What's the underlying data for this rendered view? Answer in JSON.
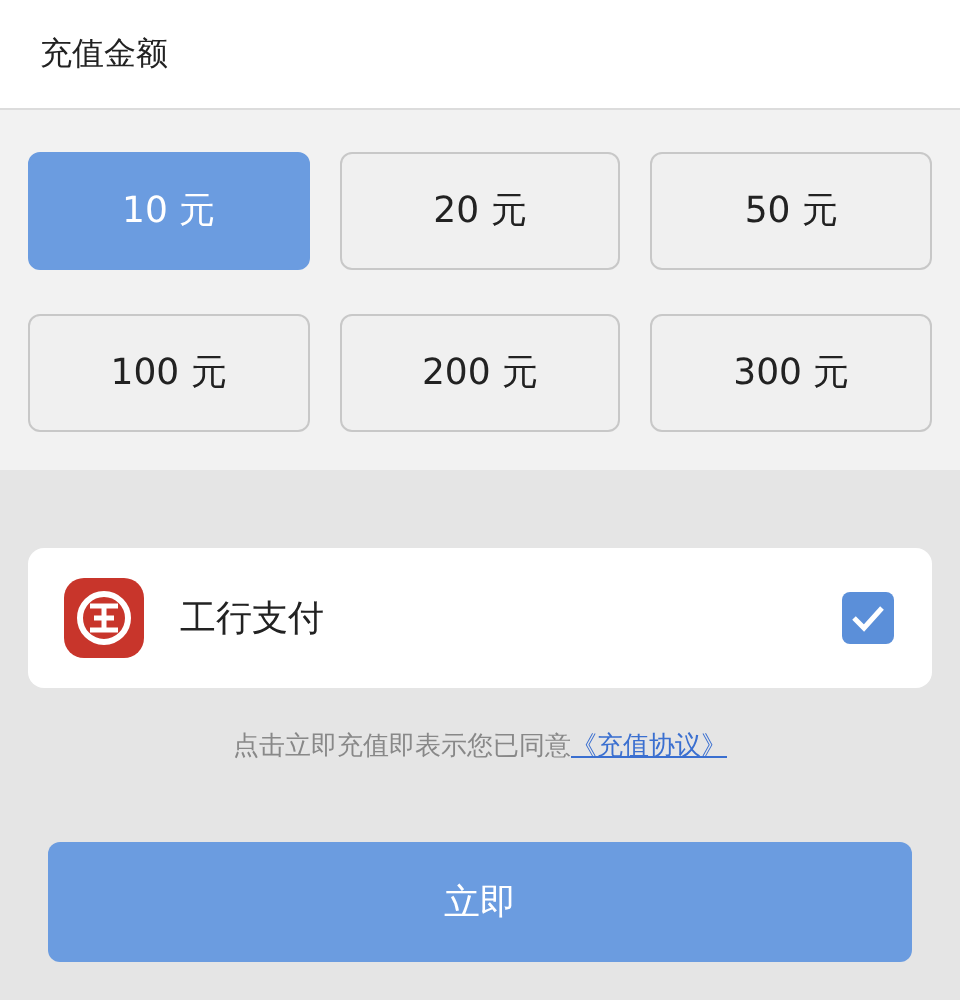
{
  "header": {
    "title": "充值金额"
  },
  "amounts": [
    {
      "label": "10 元",
      "selected": true
    },
    {
      "label": "20 元",
      "selected": false
    },
    {
      "label": "50 元",
      "selected": false
    },
    {
      "label": "100 元",
      "selected": false
    },
    {
      "label": "200 元",
      "selected": false
    },
    {
      "label": "300 元",
      "selected": false
    }
  ],
  "payment": {
    "label": "工行支付",
    "checked": true
  },
  "agreement": {
    "text": "点击立即充值即表示您已同意",
    "link": "《充值协议》"
  },
  "submit": {
    "label": "立即"
  }
}
